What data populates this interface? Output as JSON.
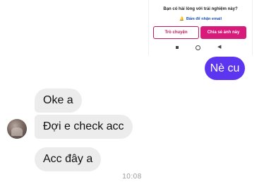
{
  "shared_screenshot": {
    "question": "Bạn có hài lòng với trải nghiệm này?",
    "email_link": "Bấm để nhận email",
    "chat_button": "Trò chuyện",
    "share_button": "Chia sẻ ảnh này",
    "nav_icons": [
      "square-nav-icon",
      "circle-nav-icon",
      "back-triangle-icon"
    ]
  },
  "messages": {
    "sent": [
      {
        "text": "Nè cu"
      }
    ],
    "received": [
      {
        "text": "Oke a"
      },
      {
        "text": "Đợi e check acc"
      },
      {
        "text": "Acc đây a"
      }
    ]
  },
  "timestamp": "10:08",
  "colors": {
    "sent_bubble": "#5b35f0",
    "received_bubble": "#ececec",
    "accent_pink": "#d81b7a"
  }
}
